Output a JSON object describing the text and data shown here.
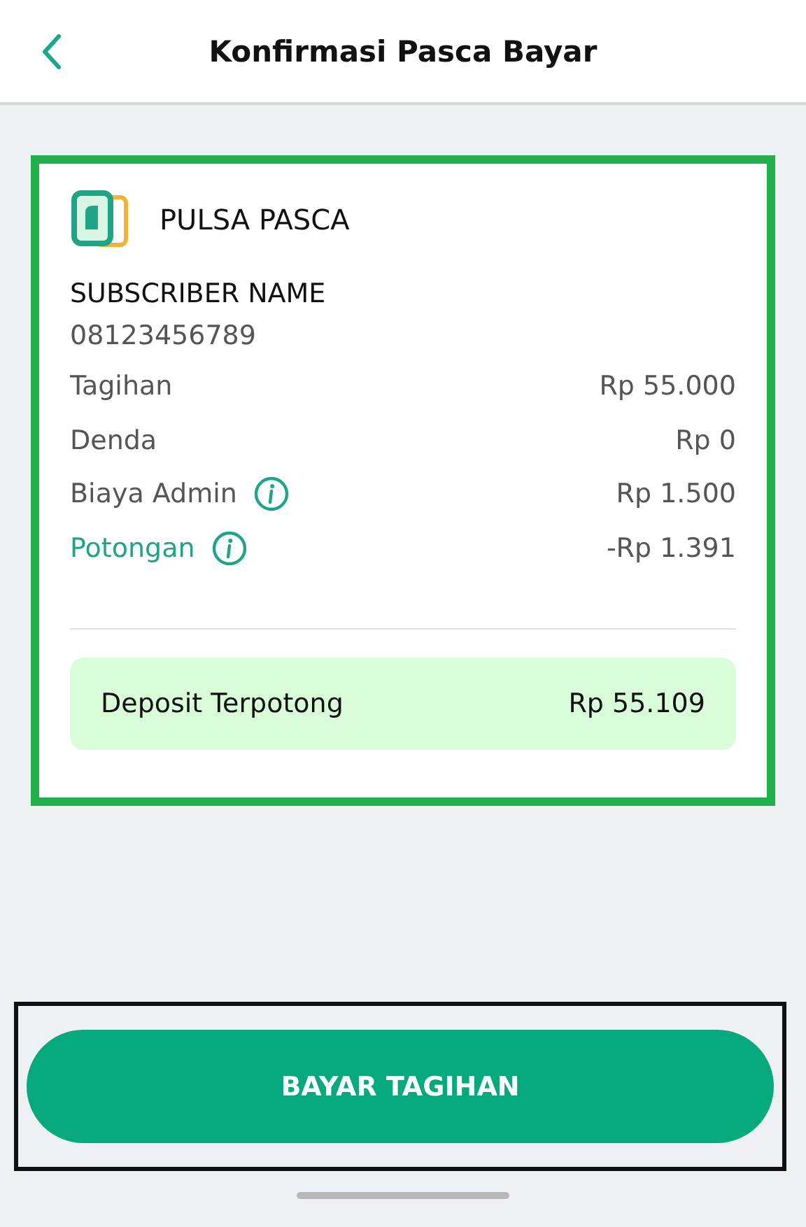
{
  "header": {
    "title": "Konfirmasi Pasca Bayar"
  },
  "card": {
    "highlighted": true,
    "product": "PULSA PASCA",
    "subscriber_name": "SUBSCRIBER NAME",
    "phone": "08123456789",
    "rows": [
      {
        "label": "Tagihan",
        "value": "Rp 55.000",
        "kind": "plain"
      },
      {
        "label": "Denda",
        "value": "Rp 0",
        "kind": "plain"
      },
      {
        "label": "Biaya Admin",
        "value": "Rp 1.500",
        "kind": "info"
      },
      {
        "label": "Potongan",
        "value": "-Rp 1.391",
        "kind": "discount"
      }
    ],
    "total": {
      "label": "Deposit Terpotong",
      "value": "Rp 55.109"
    }
  },
  "footer": {
    "highlighted": true,
    "button": "BAYAR TAGIHAN"
  }
}
